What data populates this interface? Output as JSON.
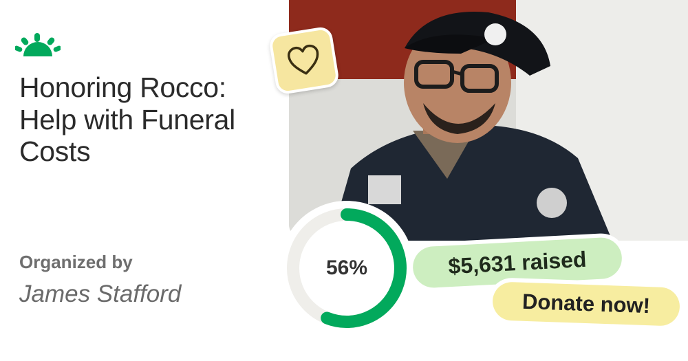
{
  "campaign": {
    "title": "Honoring Rocco: Help with Funeral Costs",
    "organized_label": "Organized by",
    "organizer_name": "James Stafford"
  },
  "progress": {
    "percent_label": "56%",
    "percent_value": 0.56
  },
  "raised_label": "$5,631 raised",
  "donate_label": "Donate now!",
  "icons": {
    "logo": "sunrise-logo-icon",
    "heart": "heart-icon"
  },
  "colors": {
    "brand_green": "#02a95c",
    "raised_pill": "#cdeec0",
    "donate_pill": "#f7eda0",
    "heart_badge": "#f6e6a0",
    "ring_track": "#efeeea"
  }
}
